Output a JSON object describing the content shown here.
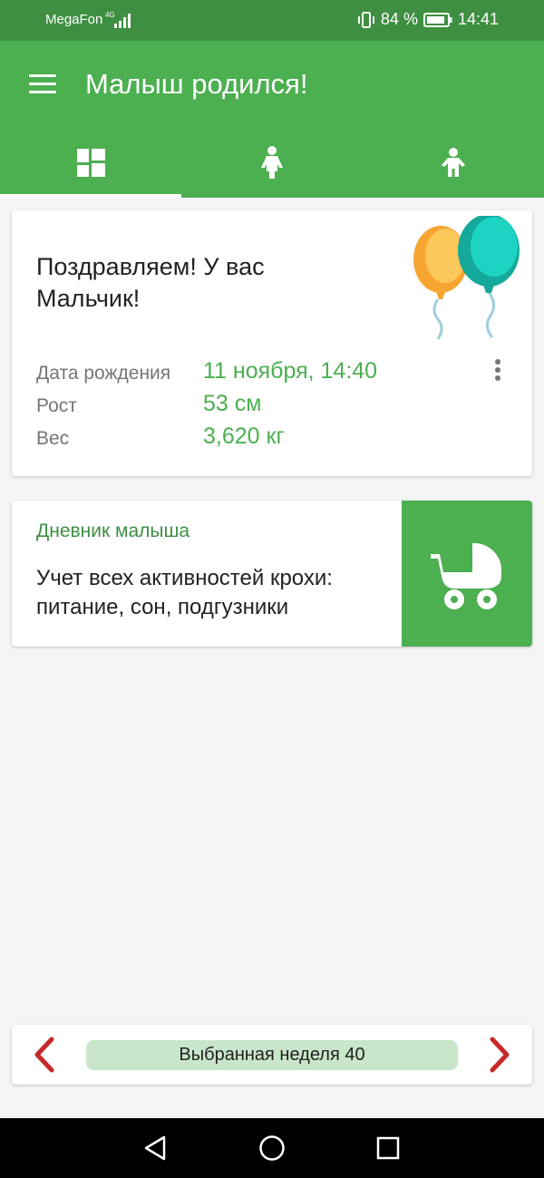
{
  "status_bar": {
    "carrier": "MegaFon",
    "network": "4G",
    "battery": "84 %",
    "time": "14:41"
  },
  "app_bar": {
    "title": "Малыш родился!",
    "tabs": [
      {
        "icon": "dashboard-icon",
        "active": true
      },
      {
        "icon": "mother-icon",
        "active": false
      },
      {
        "icon": "child-icon",
        "active": false
      }
    ]
  },
  "birth_card": {
    "congrats": "Поздравляем! У вас Мальчик!",
    "rows": [
      {
        "label": "Дата рождения",
        "value": "11 ноября, 14:40"
      },
      {
        "label": "Рост",
        "value": "53 см"
      },
      {
        "label": "Вес",
        "value": "3,620 кг"
      }
    ]
  },
  "diary_card": {
    "title": "Дневник малыша",
    "description": "Учет всех активностей крохи: питание, сон, подгузники",
    "icon": "stroller-icon"
  },
  "week_bar": {
    "label": "Выбранная неделя 40"
  },
  "colors": {
    "primary": "#4caf50",
    "primary_dark": "#3f8f43",
    "accent_arrow": "#c62828",
    "pill": "#c8e6c9"
  }
}
